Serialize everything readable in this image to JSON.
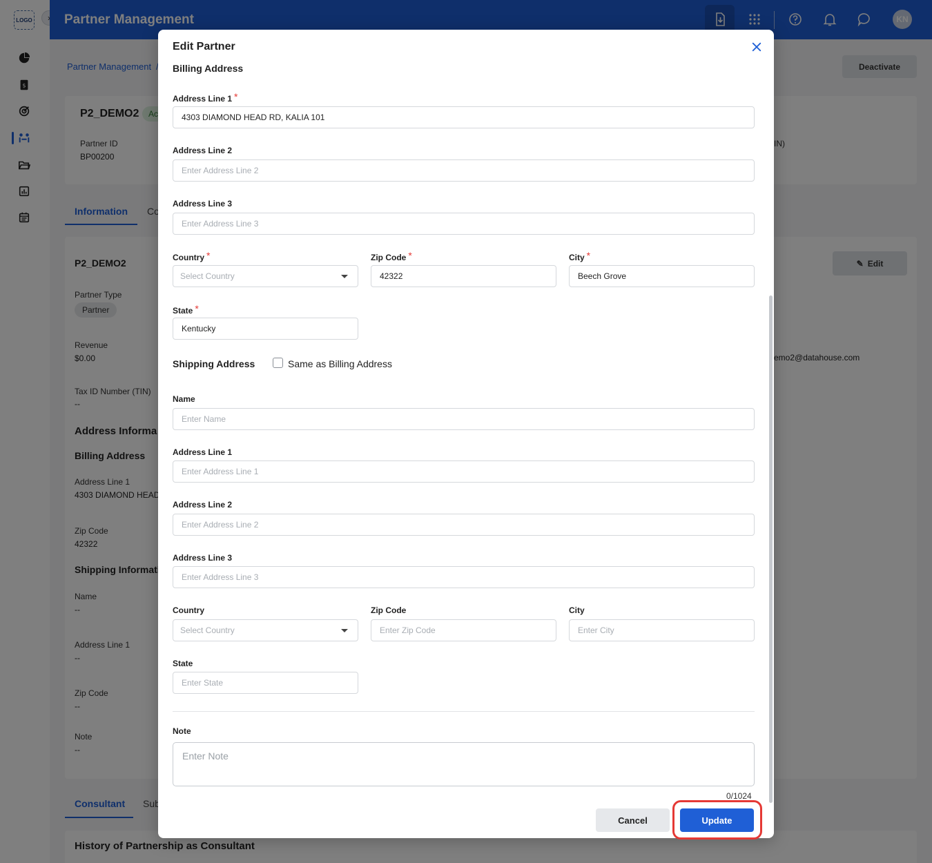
{
  "app": {
    "logo": "LOGO",
    "title": "Partner Management",
    "avatar_initials": "KN",
    "accent_color": "#1f5fd6"
  },
  "background": {
    "breadcrumb": "Partner Management",
    "breadcrumb_sep": "/",
    "deactivate_label": "Deactivate",
    "partner_name": "P2_DEMO2",
    "status_badge": "Ac",
    "partner_id_label": "Partner ID",
    "partner_id_value": "BP00200",
    "tin_partial": "IN)",
    "tabs": {
      "information": "Information",
      "second_partial": "Co"
    },
    "card_title": "P2_DEMO2",
    "edit_label": "Edit",
    "partner_type_label": "Partner Type",
    "partner_type_value": "Partner",
    "revenue_label": "Revenue",
    "revenue_value": "$0.00",
    "email_partial": "emo2@datahouse.com",
    "tin_label": "Tax ID Number (TIN)",
    "tin_value": "--",
    "address_info_title": "Address Informa",
    "billing_title": "Billing Address",
    "addr1_label": "Address Line 1",
    "addr1_value": "4303 DIAMOND HEAD",
    "zip_label": "Zip Code",
    "zip_value": "42322",
    "shipping_title": "Shipping Informati",
    "name_label": "Name",
    "name_value": "--",
    "ship_addr1_label": "Address Line 1",
    "ship_addr1_value": "--",
    "ship_zip_label": "Zip Code",
    "ship_zip_value": "--",
    "note_label": "Note",
    "note_value": "--",
    "bottom_tabs": {
      "consultant": "Consultant",
      "second_partial": "Sub"
    },
    "history_title": "History of Partnership as Consultant"
  },
  "modal": {
    "title": "Edit Partner",
    "billing": {
      "section_title": "Billing Address",
      "address_line_1": {
        "label": "Address Line 1",
        "value": "4303 DIAMOND HEAD RD, KALIA 101",
        "required": "*"
      },
      "address_line_2": {
        "label": "Address Line 2",
        "placeholder": "Enter Address Line 2"
      },
      "address_line_3": {
        "label": "Address Line 3",
        "placeholder": "Enter Address Line 3"
      },
      "country": {
        "label": "Country",
        "placeholder": "Select Country",
        "required": "*"
      },
      "zip_code": {
        "label": "Zip Code",
        "value": "42322",
        "required": "*"
      },
      "city": {
        "label": "City",
        "value": "Beech Grove",
        "required": "*"
      },
      "state": {
        "label": "State",
        "value": "Kentucky",
        "required": "*"
      }
    },
    "shipping": {
      "section_title": "Shipping Address",
      "same_as_billing_label": "Same as Billing Address",
      "same_as_billing_checked": false,
      "name": {
        "label": "Name",
        "placeholder": "Enter Name"
      },
      "address_line_1": {
        "label": "Address Line 1",
        "placeholder": "Enter Address Line 1"
      },
      "address_line_2": {
        "label": "Address Line 2",
        "placeholder": "Enter Address Line 2"
      },
      "address_line_3": {
        "label": "Address Line 3",
        "placeholder": "Enter Address Line 3"
      },
      "country": {
        "label": "Country",
        "placeholder": "Select Country"
      },
      "zip_code": {
        "label": "Zip Code",
        "placeholder": "Enter Zip Code"
      },
      "city": {
        "label": "City",
        "placeholder": "Enter City"
      },
      "state": {
        "label": "State",
        "placeholder": "Enter State"
      }
    },
    "note": {
      "label": "Note",
      "placeholder": "Enter Note",
      "counter": "0/1024"
    },
    "buttons": {
      "cancel": "Cancel",
      "update": "Update"
    }
  }
}
